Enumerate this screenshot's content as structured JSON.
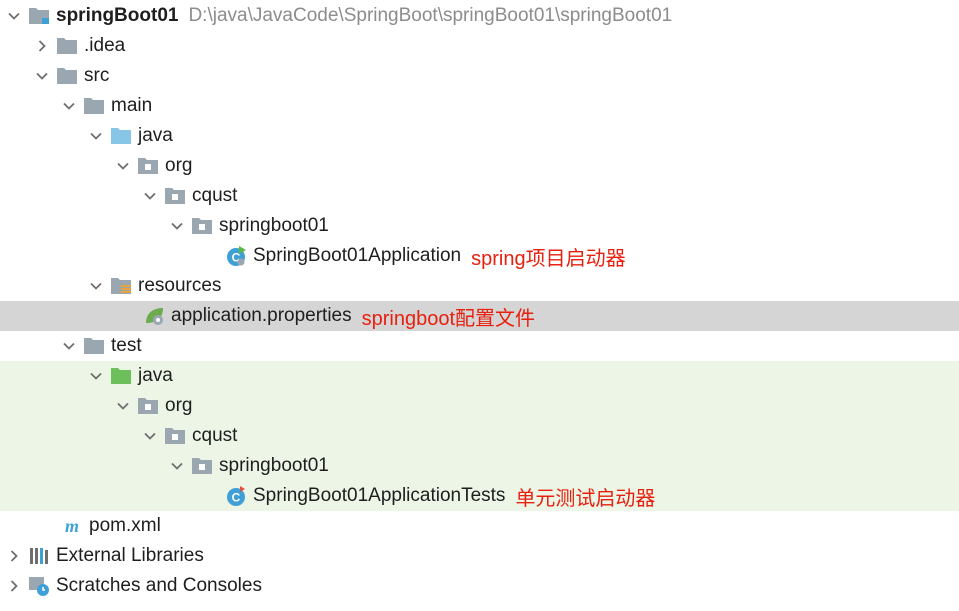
{
  "project": {
    "name": "springBoot01",
    "path": "D:\\java\\JavaCode\\SpringBoot\\springBoot01\\springBoot01"
  },
  "nodes": {
    "idea": ".idea",
    "src": "src",
    "main": "main",
    "main_java": "java",
    "main_org": "org",
    "main_cqust": "cqust",
    "main_springboot01": "springboot01",
    "app_class": "SpringBoot01Application",
    "resources": "resources",
    "app_properties": "application.properties",
    "test": "test",
    "test_java": "java",
    "test_org": "org",
    "test_cqust": "cqust",
    "test_springboot01": "springboot01",
    "test_class": "SpringBoot01ApplicationTests",
    "pom": "pom.xml",
    "external_libraries": "External Libraries",
    "scratches": "Scratches and Consoles"
  },
  "annotations": {
    "app_class": "spring项目启动器",
    "app_properties": "springboot配置文件",
    "test_class": "单元测试启动器"
  },
  "colors": {
    "selected_row": "#d5d5d5",
    "test_row": "#ecf5e6",
    "annotation": "#e8200f",
    "folder": "#9aa7b0",
    "source_folder": "#87c6e6",
    "test_folder": "#6dbf5b"
  }
}
